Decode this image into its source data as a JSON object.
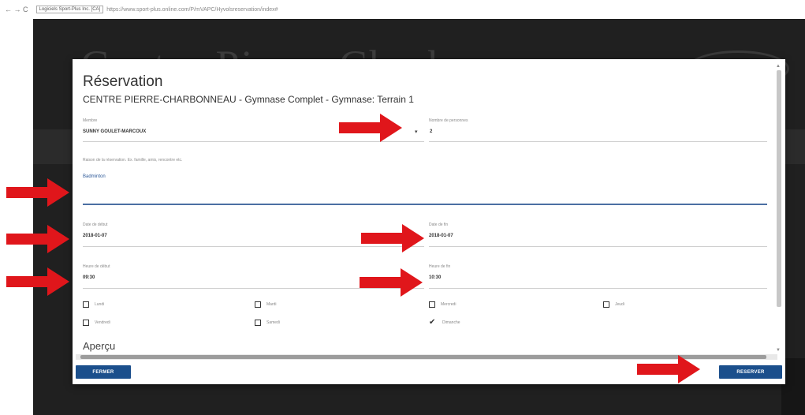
{
  "browser": {
    "nav_glyphs": "← → C",
    "secure_label": "Logiciels Sport-Plus Inc. [CA]",
    "url": "https://www.sport-plus.online.com/P/mVAPC/Hyvolsreservation/index#"
  },
  "background": {
    "heading": "Centre Pierre Charbonneau"
  },
  "dialog": {
    "title": "Réservation",
    "subtitle": "CENTRE PIERRE-CHARBONNEAU - Gymnase Complet - Gymnase: Terrain 1",
    "member": {
      "label": "Membre",
      "value": "SUNNY GOULET-MARCOUX"
    },
    "people": {
      "label": "Nombre de personnes",
      "value": "2"
    },
    "reason": {
      "label": "Raison de la réservation. Ex. famille, amis, rencontre etc.",
      "value": "Badminton"
    },
    "start_date": {
      "label": "Date de début",
      "value": "2018-01-07"
    },
    "end_date": {
      "label": "Date de fin",
      "value": "2018-01-07"
    },
    "start_time": {
      "label": "Heure de début",
      "value": "09:30"
    },
    "end_time": {
      "label": "Heure de fin",
      "value": "10:30"
    },
    "days": [
      {
        "label": "Lundi",
        "checked": false
      },
      {
        "label": "Mardi",
        "checked": false
      },
      {
        "label": "Mercredi",
        "checked": false
      },
      {
        "label": "Jeudi",
        "checked": false
      },
      {
        "label": "Vendredi",
        "checked": false
      },
      {
        "label": "Samedi",
        "checked": false
      },
      {
        "label": "Dimanche",
        "checked": true
      }
    ],
    "preview_heading": "Aperçu",
    "close_button": "FERMER",
    "reserve_button": "RESERVER"
  },
  "colors": {
    "primary_button": "#1b4f8c",
    "accent_line": "#4b6fa3",
    "arrow": "#e0161b"
  },
  "icons": {
    "dropdown": "▾",
    "checkmark": "✔"
  }
}
